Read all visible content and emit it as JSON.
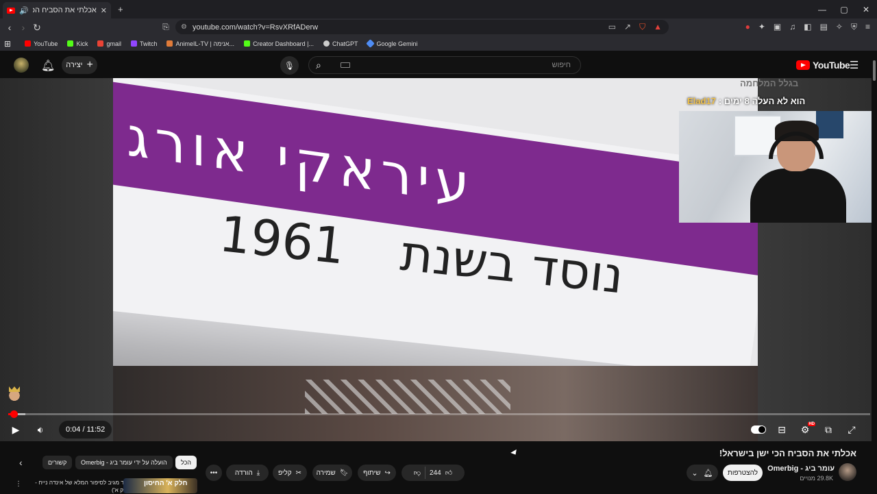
{
  "browser": {
    "tab_title": "אכלתי את הסביח הכי ישן בישראל!",
    "new_tab": "+",
    "url": "youtube.com/watch?v=RsvXRfADerw",
    "window_controls": [
      "—",
      "▢",
      "✕"
    ],
    "bookmarks": [
      {
        "label": "YouTube",
        "color": "#ff0000"
      },
      {
        "label": "Kick",
        "color": "#53fc18"
      },
      {
        "label": "gmail",
        "color": "#ea4335"
      },
      {
        "label": "Twitch",
        "color": "#9146ff"
      },
      {
        "label": "AnimeIL-TV | אנימה...",
        "color": "#e07b39"
      },
      {
        "label": "Creator Dashboard |...",
        "color": "#53fc18"
      },
      {
        "label": "ChatGPT",
        "color": "#cccccc"
      },
      {
        "label": "Google Gemini",
        "color": "#4f8df5"
      }
    ]
  },
  "youtube": {
    "create_label": "יצירה",
    "search_placeholder": "חיפוש",
    "logo_text": "YouTube"
  },
  "video": {
    "overlay_line1": "בגלל המלחמה",
    "overlay_user": "Elad17",
    "overlay_line2": "הוא לא העלה 8 ימים :",
    "sign_text": "עיראקי אורג",
    "sign_founded": "נוסד בשנת",
    "sign_year": "1961",
    "time": "0:04 / 11:52",
    "progress_fraction": 0.0057
  },
  "below": {
    "title": "אכלתי את הסביח הכי ישן בישראל!",
    "channel_name": "עומר ביג - Omerbig",
    "subscribers": "29.8K מנויים",
    "subscribe_label": "להצטרפות",
    "likes": "244",
    "share_label": "שיתוף",
    "save_label": "שמירה",
    "clip_label": "קליפ",
    "download_label": "הורדה",
    "chips": {
      "all": "הכל",
      "uploaded_by": "הועלה על ידי עומר ביג - Omerbig",
      "related": "קשורים"
    },
    "rec_title": "עודד מגיב לסיפור המלא של אינדה נייח - (חלק א')",
    "rec_thumb_text": "חלק א' החיסון"
  }
}
